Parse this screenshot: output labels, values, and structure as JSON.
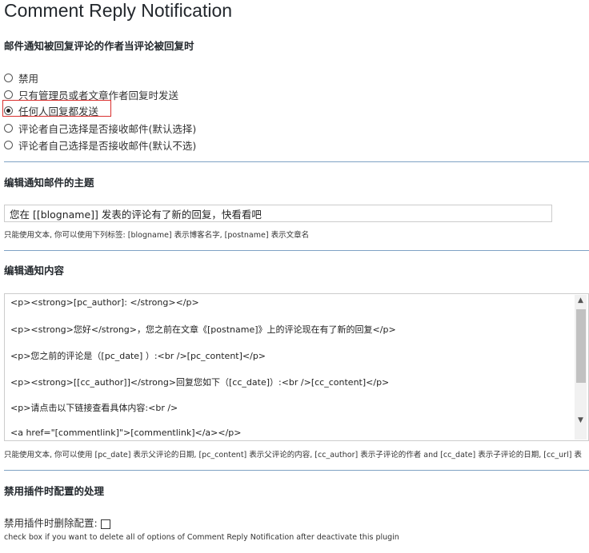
{
  "title": "Comment Reply Notification",
  "notify_section": {
    "heading": "邮件通知被回复评论的作者当评论被回复时",
    "options": [
      {
        "label": "禁用",
        "checked": false
      },
      {
        "label": "只有管理员或者文章作者回复时发送",
        "checked": false
      },
      {
        "label": "任何人回复都发送",
        "checked": true
      },
      {
        "label": "评论者自己选择是否接收邮件(默认选择)",
        "checked": false
      },
      {
        "label": "评论者自己选择是否接收邮件(默认不选)",
        "checked": false
      }
    ]
  },
  "subject_section": {
    "heading": "编辑通知邮件的主题",
    "value": "您在 [[blogname]] 发表的评论有了新的回复，快看看吧",
    "hint": "只能使用文本, 你可以使用下列标签: [blogname] 表示博客名字, [postname] 表示文章名"
  },
  "content_section": {
    "heading": "编辑通知内容",
    "lines": [
      "<p><strong>[pc_author]: </strong></p>",
      "<p><strong>您好</strong>，您之前在文章《[postname]》上的评论现在有了新的回复</p>",
      "<p>您之前的评论是（[pc_date] ）:<br />[pc_content]</p>",
      "<p><strong>[[cc_author]]</strong>回复您如下（[cc_date]）:<br />[cc_content]</p>",
      "<p>请点击以下链接查看具体内容:<br />",
      "<a href=\"[commentlink]\">[commentlink]</a></p>"
    ],
    "hint": "只能使用文本, 你可以使用 [pc_date] 表示父评论的日期, [pc_content] 表示父评论的内容, [cc_author] 表示子评论的作者 and [cc_date] 表示子评论的日期, [cc_url] 表"
  },
  "deactivate_section": {
    "heading": "禁用插件时配置的处理",
    "checkbox_label": "禁用插件时删除配置:",
    "checked": false,
    "hint": "check box if you want to delete all of options of Comment Reply Notification after deactivate this plugin"
  },
  "colors": {
    "divider": "#7fa2c4",
    "highlight": "#d9302e"
  }
}
